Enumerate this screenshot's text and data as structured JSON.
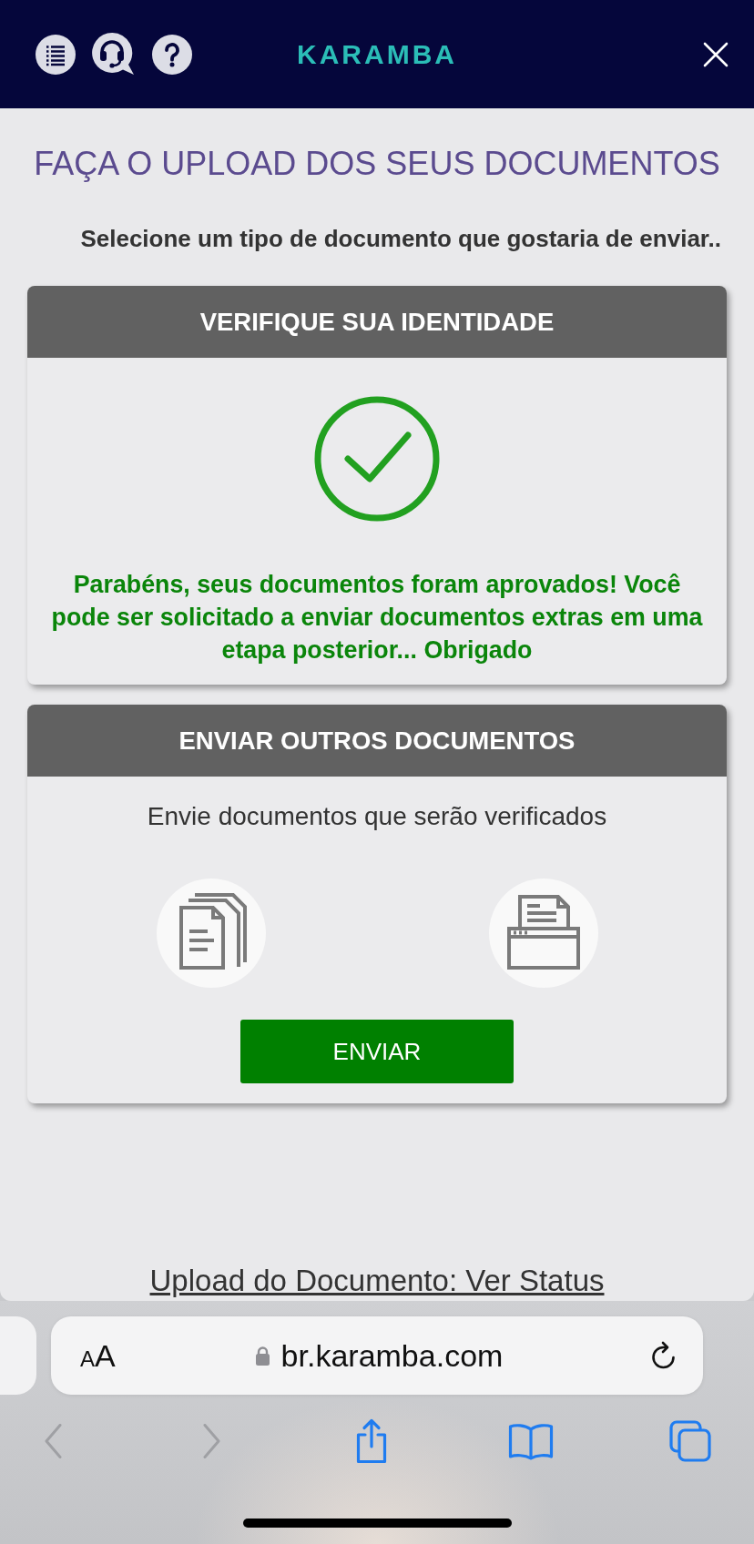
{
  "header": {
    "logo": "KARAMBA"
  },
  "page": {
    "title": "FAÇA O UPLOAD DOS SEUS DOCUMENTOS",
    "subtitle": "Selecione um tipo de documento que gostaria de enviar.."
  },
  "cards": [
    {
      "kind": "approved",
      "title": "VERIFIQUE SUA IDENTIDADE",
      "message": "Parabéns, seus documentos foram aprovados! Você pode ser solicitado a enviar documentos extras em uma etapa posterior... Obrigado"
    },
    {
      "kind": "upload",
      "title": "ENVIAR OUTROS DOCUMENTOS",
      "description": "Envie documentos que serão verificados",
      "button": "ENVIAR"
    }
  ],
  "status_link": "Upload do Documento: Ver Status",
  "browser": {
    "text_size_button": "AA",
    "url": "br.karamba.com",
    "toolbar": [
      {
        "kind": "back",
        "disabled": true
      },
      {
        "kind": "forward",
        "disabled": true
      },
      {
        "kind": "share",
        "disabled": false
      },
      {
        "kind": "bookmarks",
        "disabled": false
      },
      {
        "kind": "tabs",
        "disabled": false
      }
    ]
  }
}
